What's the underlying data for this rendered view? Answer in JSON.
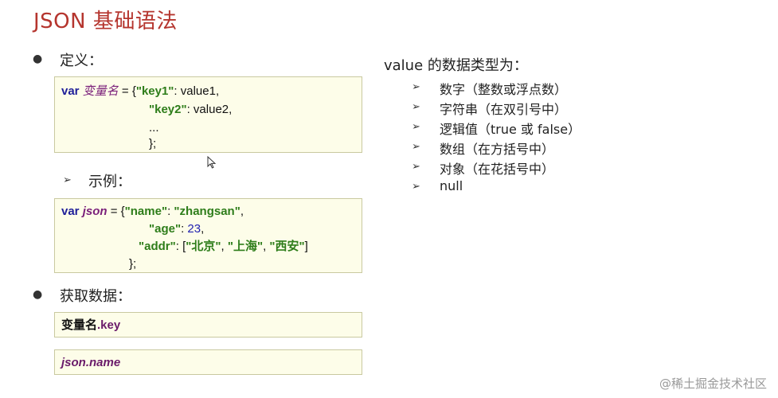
{
  "title": "JSON 基础语法",
  "definition": {
    "label": "定义：",
    "code": {
      "var_kw": "var",
      "var_name": "变量名",
      "line1_eq": " = {",
      "line1_key": "\"key1\"",
      "line1_val": ": value1,",
      "line2_key": "\"key2\"",
      "line2_val": ": value2,",
      "line3": "...",
      "line4": "};"
    }
  },
  "example": {
    "label": "示例：",
    "code": {
      "var_kw": "var",
      "var_name": "json",
      "line1_eq": " = {",
      "name_key": "\"name\"",
      "colon1": ": ",
      "name_val": "\"zhangsan\"",
      "comma1": ",",
      "age_key": "\"age\"",
      "age_colon": ": ",
      "age_val": "23",
      "comma2": ",",
      "addr_key": "\"addr\"",
      "addr_open": ": [",
      "addr_v1": "\"北京\"",
      "sep1": ", ",
      "addr_v2": "\"上海\"",
      "sep2": ", ",
      "addr_v3": "\"西安\"",
      "addr_close": "]",
      "end": "};"
    }
  },
  "access": {
    "label": "获取数据：",
    "box1_var": "变量名",
    "box1_key": ".key",
    "box2": "json.name"
  },
  "types": {
    "heading": "value 的数据类型为：",
    "items": [
      "数字（整数或浮点数）",
      "字符串（在双引号中）",
      "逻辑值（true 或 false）",
      "数组（在方括号中）",
      "对象（在花括号中）",
      "null"
    ]
  },
  "watermark": "@稀土掘金技术社区",
  "colors": {
    "title": "#b5352e",
    "box_bg": "#fdfde9",
    "key_green": "#2e7d1a",
    "keyword_blue": "#1f1f99"
  }
}
